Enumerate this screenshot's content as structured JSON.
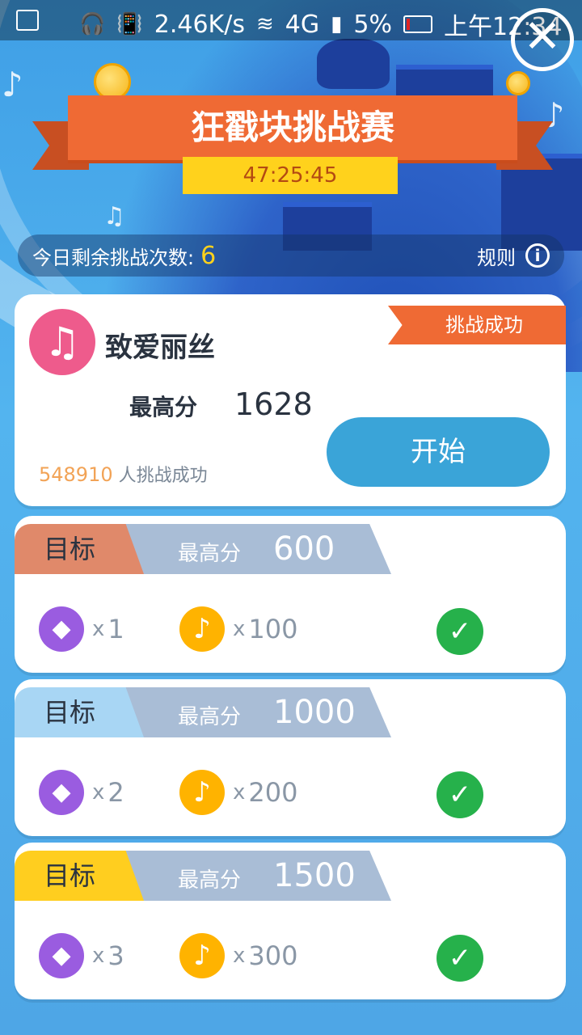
{
  "status_bar": {
    "speed": "2.46K/s",
    "network": "4G",
    "battery": "5%",
    "time": "上午12:34"
  },
  "event": {
    "title": "狂戳块挑战赛",
    "countdown": "47:25:45",
    "attempts_label": "今日剩余挑战次数:",
    "attempts_count": "6",
    "rules_label": "规则"
  },
  "song": {
    "title": "致爱丽丝",
    "status_flag": "挑战成功",
    "best_label": "最高分",
    "best_score": "1628",
    "start_label": "开始",
    "success_count": "548910",
    "success_text": "人挑战成功"
  },
  "goals": [
    {
      "tag": "目标",
      "label": "最高分",
      "score": "600",
      "gem_mult": "x",
      "gem_qty": "1",
      "note_mult": "x",
      "note_qty": "100",
      "tag_color": "#e0896a",
      "done": true
    },
    {
      "tag": "目标",
      "label": "最高分",
      "score": "1000",
      "gem_mult": "x",
      "gem_qty": "2",
      "note_mult": "x",
      "note_qty": "200",
      "tag_color": "#a8d6f4",
      "done": true
    },
    {
      "tag": "目标",
      "label": "最高分",
      "score": "1500",
      "gem_mult": "x",
      "gem_qty": "3",
      "note_mult": "x",
      "note_qty": "300",
      "tag_color": "#ffce1f",
      "done": true
    }
  ],
  "icons": {
    "close": "close-icon",
    "info": "info-icon",
    "song": "music-note-icon",
    "gem": "diamond-icon",
    "note": "music-note-coin-icon",
    "check": "check-icon"
  }
}
